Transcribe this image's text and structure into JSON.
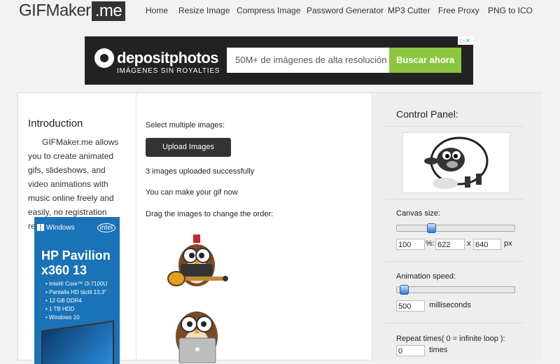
{
  "logo": {
    "brand": "GIFMaker",
    "tld": ".me"
  },
  "nav": [
    {
      "label": "Home"
    },
    {
      "label": "Resize Image"
    },
    {
      "label": "Compress Image"
    },
    {
      "label": "Password Generator"
    },
    {
      "label": "MP3 Cutter"
    },
    {
      "label": "Free Proxy"
    },
    {
      "label": "PNG to ICO"
    }
  ],
  "banner_ad": {
    "brand": "depositphotos",
    "tagline": "IMÁGENES SIN ROYALTIES",
    "search_text": "50M+ de imágenes de alta resolución",
    "button": "Buscar ahora",
    "adchoice": "▷✕"
  },
  "intro": {
    "title": "Introduction",
    "text": "GIFMaker.me allows you to create animated gifs, slideshows, and video animations with music online freely and easily, no registration required."
  },
  "side_ad": {
    "windows": "Windows",
    "intel": "intel",
    "title": "HP Pavilion x360 13",
    "specs": [
      "Intel® Core™ i3-7100U",
      "Pantalla HD táctil 13,3\"",
      "12 GB DDR4",
      "1 TB HDD",
      "Windows 10"
    ]
  },
  "middle": {
    "select_label": "Select multiple images:",
    "upload_button": "Upload Images",
    "status": "3 images uploaded successfully",
    "can_make": "You can make your gif now",
    "drag_hint": "Drag the images to change the order:"
  },
  "panel": {
    "title": "Control Panel:",
    "canvas_label": "Canvas size:",
    "canvas_percent": "100",
    "percent_sep": "%:",
    "canvas_width": "622",
    "x_sep": "x",
    "canvas_height": "640",
    "px_unit": "px",
    "canvas_slider_pct": 29,
    "speed_label": "Animation speed:",
    "speed_value": "500",
    "speed_unit": "milliseconds",
    "speed_slider_pct": 6,
    "repeat_label": "Repeat times( 0 = infinite loop ):",
    "repeat_value": "0",
    "repeat_unit": "times"
  },
  "colors": {
    "accent_green": "#8cc63f",
    "dark": "#333333"
  }
}
